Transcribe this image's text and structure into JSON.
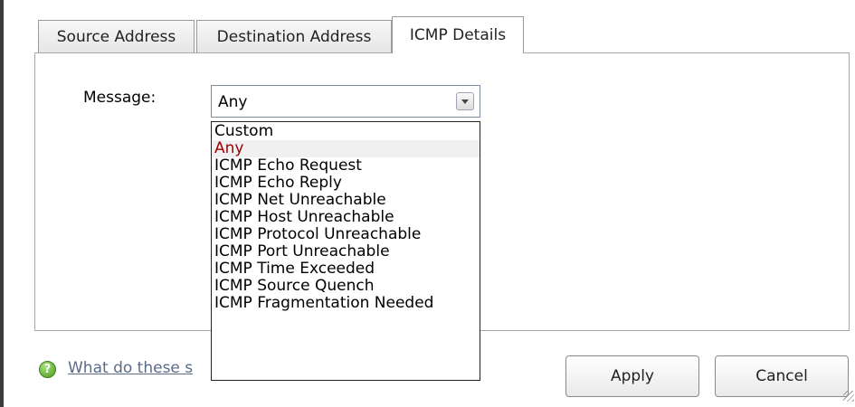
{
  "tabs": {
    "source": "Source Address",
    "destination": "Destination Address",
    "icmp": "ICMP Details"
  },
  "form": {
    "message_label": "Message:",
    "message_value": "Any"
  },
  "dropdown": {
    "options": [
      "Custom",
      "Any",
      "ICMP Echo Request",
      "ICMP Echo Reply",
      "ICMP Net Unreachable",
      "ICMP Host Unreachable",
      "ICMP Protocol Unreachable",
      "ICMP Port Unreachable",
      "ICMP Time Exceeded",
      "ICMP Source Quench",
      "ICMP Fragmentation Needed"
    ],
    "selected": "Any"
  },
  "help": {
    "icon": "help-icon",
    "link_text": "What do these s"
  },
  "buttons": {
    "apply": "Apply",
    "cancel": "Cancel"
  },
  "colors": {
    "selected_text": "#a00000",
    "link": "#5a6b88"
  }
}
